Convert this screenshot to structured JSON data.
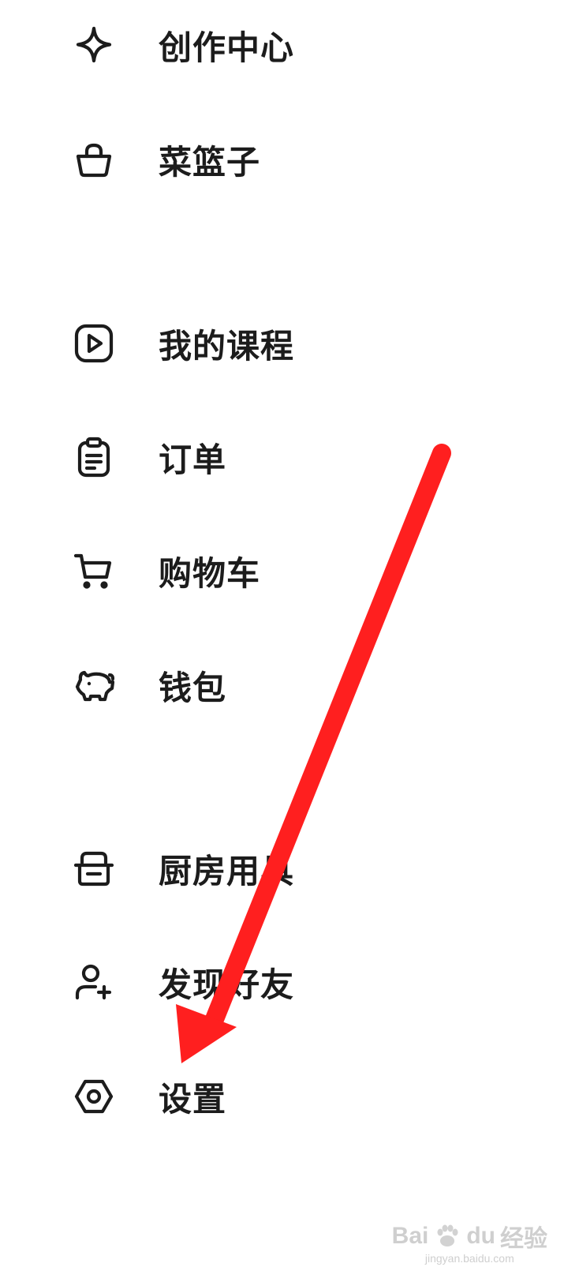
{
  "menu": {
    "items": [
      {
        "id": "creation",
        "label": "创作中心",
        "icon": "sparkle-icon"
      },
      {
        "id": "basket",
        "label": "菜篮子",
        "icon": "basket-icon"
      },
      {
        "id": "courses",
        "label": "我的课程",
        "icon": "play-square-icon"
      },
      {
        "id": "orders",
        "label": "订单",
        "icon": "clipboard-icon"
      },
      {
        "id": "cart",
        "label": "购物车",
        "icon": "cart-icon"
      },
      {
        "id": "wallet",
        "label": "钱包",
        "icon": "piggy-bank-icon"
      },
      {
        "id": "kitchenware",
        "label": "厨房用具",
        "icon": "pot-icon"
      },
      {
        "id": "find_friends",
        "label": "发现好友",
        "icon": "add-user-icon"
      },
      {
        "id": "settings",
        "label": "设置",
        "icon": "hexagon-gear-icon"
      }
    ]
  },
  "annotation": {
    "arrow_color": "#ff1f1f",
    "points_to": "settings"
  },
  "watermark": {
    "brand_text": "Bai",
    "brand_text_2": "du",
    "jingyan_text": "经验",
    "url_text": "jingyan.baidu.com"
  },
  "colors": {
    "text": "#1c1c1c",
    "icon_stroke": "#1c1c1c",
    "background": "#ffffff"
  }
}
